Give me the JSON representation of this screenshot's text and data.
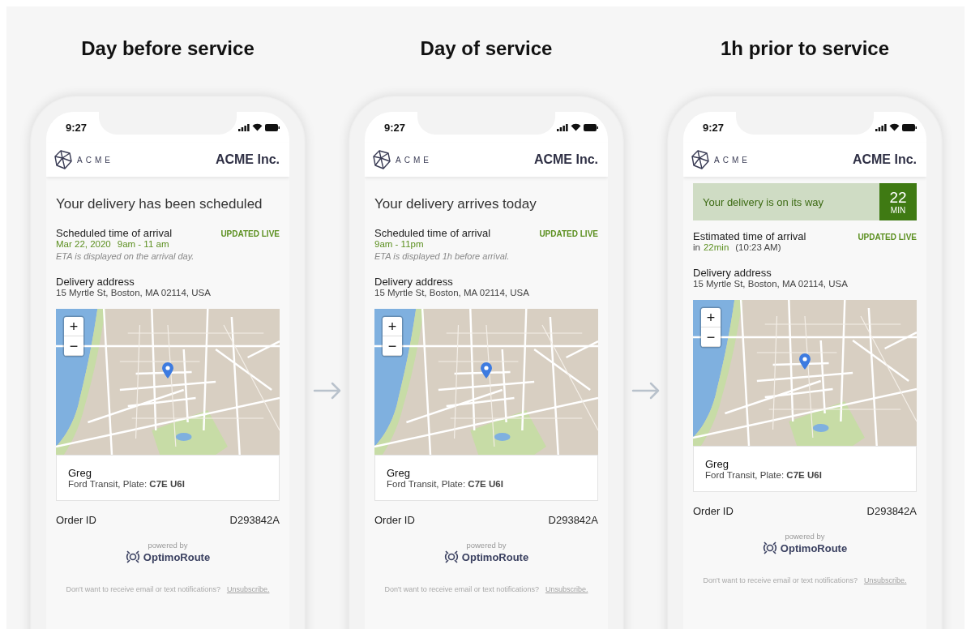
{
  "stages": [
    {
      "title": "Day before service",
      "phone": {
        "time": "9:27",
        "brand": "ACME",
        "company": "ACME Inc.",
        "header": {
          "kind": "heading",
          "text": "Your delivery has been scheduled"
        },
        "arrival_label": "Scheduled time of arrival",
        "live_badge": "UPDATED LIVE",
        "arrival_time": [
          {
            "text": "Mar 22, 2020",
            "highlight": true
          },
          {
            "text": "9am - 11 am",
            "highlight": true
          }
        ],
        "note": "ETA is displayed on the arrival day.",
        "address_label": "Delivery address",
        "address": "15 Myrtle St, Boston, MA 02114, USA",
        "zoom_in": "+",
        "zoom_out": "−",
        "driver": "Greg",
        "vehicle": "Ford Transit, Plate: **C7E U6I**",
        "order_label": "Order ID",
        "order_id": "D293842A",
        "powered_by": "powered by",
        "provider": "OptimoRoute",
        "footer": "Don't want to receive email or text notifications?",
        "unsubscribe": "Unsubscribe."
      }
    },
    {
      "title": "Day of service",
      "phone": {
        "time": "9:27",
        "brand": "ACME",
        "company": "ACME Inc.",
        "header": {
          "kind": "heading",
          "text": "Your delivery arrives today"
        },
        "arrival_label": "Scheduled time of arrival",
        "live_badge": "UPDATED LIVE",
        "arrival_time": [
          {
            "text": "9am - 11pm",
            "highlight": true
          }
        ],
        "note": "ETA is displayed 1h before arrival.",
        "address_label": "Delivery address",
        "address": "15 Myrtle St, Boston, MA 02114, USA",
        "zoom_in": "+",
        "zoom_out": "−",
        "driver": "Greg",
        "vehicle": "Ford Transit, Plate: **C7E U6I**",
        "order_label": "Order ID",
        "order_id": "D293842A",
        "powered_by": "powered by",
        "provider": "OptimoRoute",
        "footer": "Don't want to receive email or text notifications?",
        "unsubscribe": "Unsubscribe."
      }
    },
    {
      "title": "1h prior to service",
      "phone": {
        "time": "9:27",
        "brand": "ACME",
        "company": "ACME Inc.",
        "header": {
          "kind": "banner",
          "text": "Your delivery is on its way",
          "count": "22",
          "unit": "MIN"
        },
        "arrival_label": "Estimated time of arrival",
        "live_badge": "UPDATED LIVE",
        "arrival_time": [
          {
            "text": "in",
            "highlight": false
          },
          {
            "text": "22min",
            "highlight": true
          },
          {
            "text": "(10:23 AM)",
            "highlight": false
          }
        ],
        "address_label": "Delivery address",
        "address": "15 Myrtle St, Boston, MA 02114, USA",
        "zoom_in": "+",
        "zoom_out": "−",
        "driver": "Greg",
        "vehicle": "Ford Transit, Plate: **C7E U6I**",
        "order_label": "Order ID",
        "order_id": "D293842A",
        "powered_by": "powered by",
        "provider": "OptimoRoute",
        "footer": "Don't want to receive email or text notifications?",
        "unsubscribe": "Unsubscribe."
      }
    }
  ]
}
